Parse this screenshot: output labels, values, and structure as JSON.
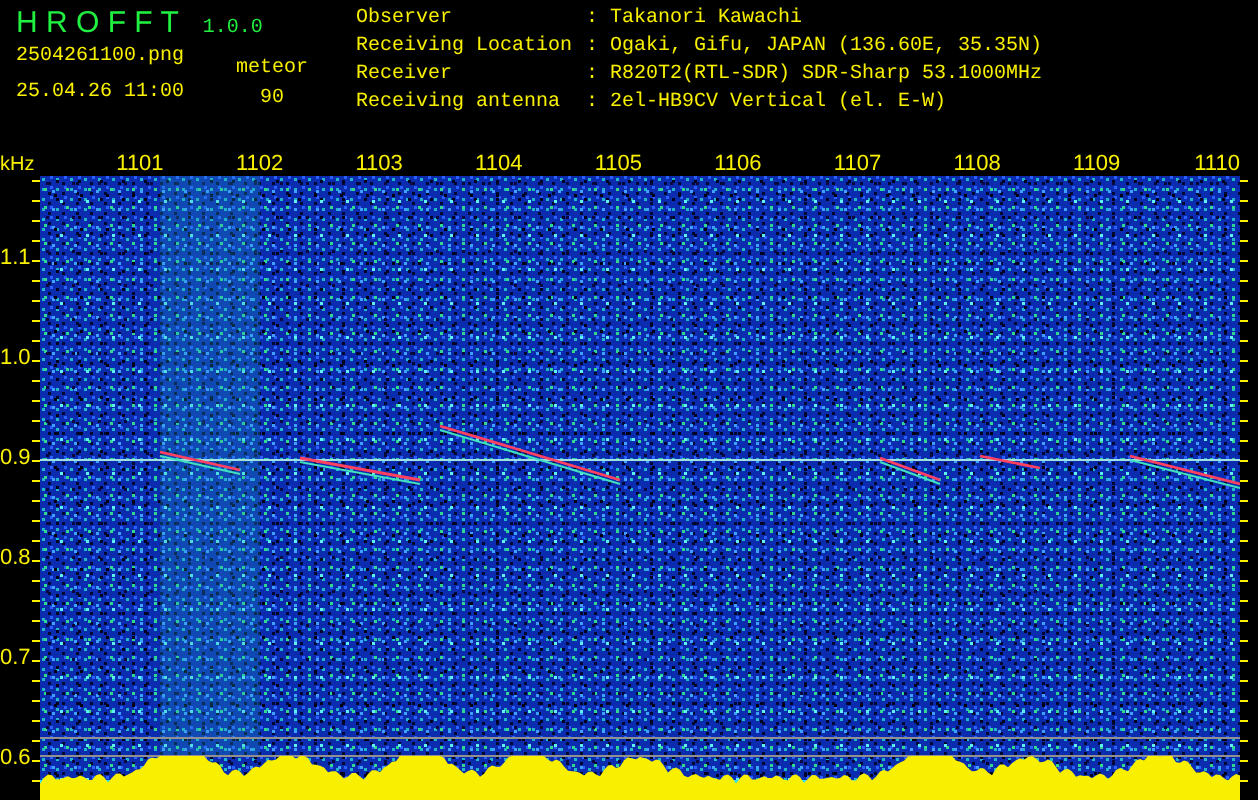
{
  "app": {
    "name": "H R O F F T",
    "version": "1.0.0"
  },
  "file": {
    "name": "2504261100.png",
    "timestamp": "25.04.26 11:00"
  },
  "count": {
    "label": "meteor",
    "value": "90"
  },
  "station": [
    {
      "label": "Observer",
      "separator": ":",
      "value": "Takanori Kawachi"
    },
    {
      "label": "Receiving Location",
      "separator": ":",
      "value": "Ogaki, Gifu, JAPAN (136.60E, 35.35N)"
    },
    {
      "label": "Receiver",
      "separator": ":",
      "value": "R820T2(RTL-SDR) SDR-Sharp 53.1000MHz"
    },
    {
      "label": "Receiving antenna",
      "separator": ":",
      "value": "2el-HB9CV Vertical (el. E-W)"
    }
  ],
  "spectrogram": {
    "unit": "kHz",
    "time_labels": [
      "1101",
      "1102",
      "1103",
      "1104",
      "1105",
      "1106",
      "1107",
      "1108",
      "1109",
      "1110"
    ],
    "freq_labels": [
      "1.1",
      "1.0",
      "0.9",
      "0.8",
      "0.7",
      "0.6"
    ]
  }
}
